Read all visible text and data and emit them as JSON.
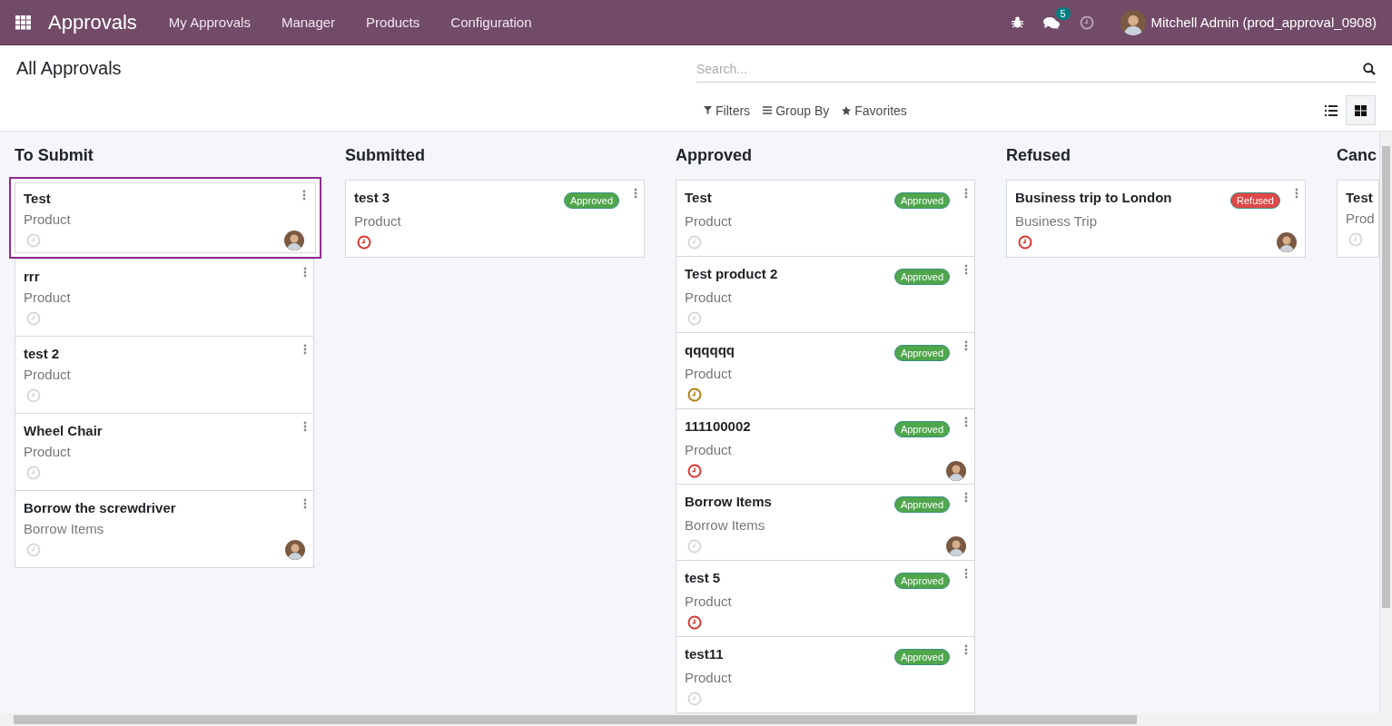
{
  "navbar": {
    "app_name": "Approvals",
    "menu": [
      "My Approvals",
      "Manager",
      "Products",
      "Configuration"
    ],
    "message_count": "5",
    "user": "Mitchell Admin (prod_approval_0908)"
  },
  "control_panel": {
    "breadcrumb": "All Approvals",
    "search": {
      "placeholder": "Search..."
    },
    "filter_buttons": [
      {
        "kind": "filter",
        "label": "Filters"
      },
      {
        "kind": "group",
        "label": "Group By"
      },
      {
        "kind": "favorite",
        "label": "Favorites"
      }
    ],
    "views": [
      {
        "kind": "list",
        "selected": false
      },
      {
        "kind": "kanban",
        "selected": true
      }
    ]
  },
  "columns": [
    {
      "title": "To Submit",
      "cards": [
        {
          "title": "Test",
          "subtitle": "Product",
          "activity": {
            "color": "#d8d8d8"
          },
          "avatar": true,
          "selected": true
        },
        {
          "title": "rrr",
          "subtitle": "Product",
          "activity": {
            "color": "#d8d8d8"
          },
          "avatar": false,
          "selected": false
        },
        {
          "title": "test 2",
          "subtitle": "Product",
          "activity": {
            "color": "#d8d8d8"
          },
          "avatar": false,
          "selected": false
        },
        {
          "title": "Wheel Chair",
          "subtitle": "Product",
          "activity": {
            "color": "#d8d8d8"
          },
          "avatar": false,
          "selected": false
        },
        {
          "title": "Borrow the screwdriver",
          "subtitle": "Borrow Items",
          "activity": {
            "color": "#d8d8d8"
          },
          "avatar": true,
          "selected": false
        }
      ]
    },
    {
      "title": "Submitted",
      "cards": [
        {
          "title": "test 3",
          "subtitle": "Product",
          "status": {
            "kind": "approved",
            "label": "Approved"
          },
          "activity": {
            "color": "#d9362e"
          },
          "avatar": false,
          "selected": false
        }
      ]
    },
    {
      "title": "Approved",
      "cards": [
        {
          "title": "Test",
          "subtitle": "Product",
          "status": {
            "kind": "approved",
            "label": "Approved"
          },
          "activity": {
            "color": "#d8d8d8"
          },
          "avatar": false,
          "selected": false
        },
        {
          "title": "Test product 2",
          "subtitle": "Product",
          "status": {
            "kind": "approved",
            "label": "Approved"
          },
          "activity": {
            "color": "#d8d8d8"
          },
          "avatar": false,
          "selected": false
        },
        {
          "title": "qqqqqq",
          "subtitle": "Product",
          "status": {
            "kind": "approved",
            "label": "Approved"
          },
          "activity": {
            "color": "#b07d12"
          },
          "avatar": false,
          "selected": false
        },
        {
          "title": "111100002",
          "subtitle": "Product",
          "status": {
            "kind": "approved",
            "label": "Approved"
          },
          "activity": {
            "color": "#d9362e"
          },
          "avatar": true,
          "selected": false
        },
        {
          "title": "Borrow Items",
          "subtitle": "Borrow Items",
          "status": {
            "kind": "approved",
            "label": "Approved"
          },
          "activity": {
            "color": "#d8d8d8"
          },
          "avatar": true,
          "selected": false
        },
        {
          "title": "test 5",
          "subtitle": "Product",
          "status": {
            "kind": "approved",
            "label": "Approved"
          },
          "activity": {
            "color": "#d9362e"
          },
          "avatar": false,
          "selected": false
        },
        {
          "title": "test11",
          "subtitle": "Product",
          "status": {
            "kind": "approved",
            "label": "Approved"
          },
          "activity": {
            "color": "#d8d8d8"
          },
          "avatar": false,
          "selected": false
        }
      ]
    },
    {
      "title": "Refused",
      "cards": [
        {
          "title": "Business trip to London",
          "subtitle": "Business Trip",
          "status": {
            "kind": "refused",
            "label": "Refused"
          },
          "activity": {
            "color": "#d9362e"
          },
          "avatar": true,
          "selected": false
        }
      ]
    },
    {
      "title": "Canc",
      "cards": [
        {
          "title": "Test",
          "subtitle": "Prod",
          "activity": {
            "color": "#d8d8d8"
          },
          "avatar": false,
          "selected": false
        }
      ]
    }
  ]
}
